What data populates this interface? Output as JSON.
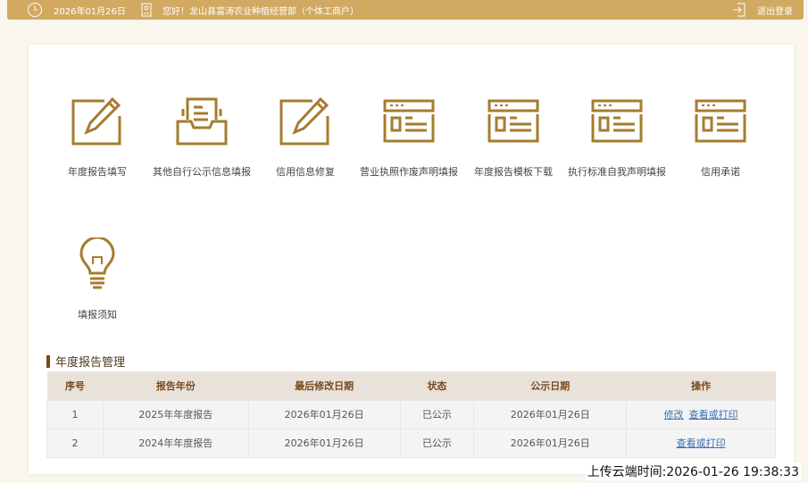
{
  "topbar": {
    "date": "2026年01月26日",
    "greeting": "您好！龙山县富涛农业种植经营部（个体工商户）",
    "logout": "退出登录"
  },
  "tiles": [
    {
      "label": "年度报告填写",
      "icon": "edit-icon"
    },
    {
      "label": "其他自行公示信息填报",
      "icon": "inbox-icon"
    },
    {
      "label": "信用信息修复",
      "icon": "edit-icon"
    },
    {
      "label": "营业执照作废声明填报",
      "icon": "form-window-icon"
    },
    {
      "label": "年度报告模板下载",
      "icon": "form-window-icon"
    },
    {
      "label": "执行标准自我声明填报",
      "icon": "form-window-icon"
    },
    {
      "label": "信用承诺",
      "icon": "form-window-icon"
    },
    {
      "label": "填报须知",
      "icon": "lightbulb-icon"
    }
  ],
  "section": {
    "title": "年度报告管理"
  },
  "table": {
    "headers": [
      "序号",
      "报告年份",
      "最后修改日期",
      "状态",
      "公示日期",
      "操作"
    ],
    "rows": [
      {
        "no": "1",
        "year": "2025年年度报告",
        "modified": "2026年01月26日",
        "status": "已公示",
        "published": "2026年01月26日",
        "actions": [
          "修改",
          "查看或打印"
        ]
      },
      {
        "no": "2",
        "year": "2024年年度报告",
        "modified": "2026年01月26日",
        "status": "已公示",
        "published": "2026年01月26日",
        "actions": [
          "查看或打印"
        ]
      }
    ]
  },
  "upload_time": "上传云端时间:2026-01-26 19:38:33",
  "colors": {
    "gold": "#d1a961",
    "icon": "#a67c2e",
    "header_text": "#7a4a1a"
  }
}
